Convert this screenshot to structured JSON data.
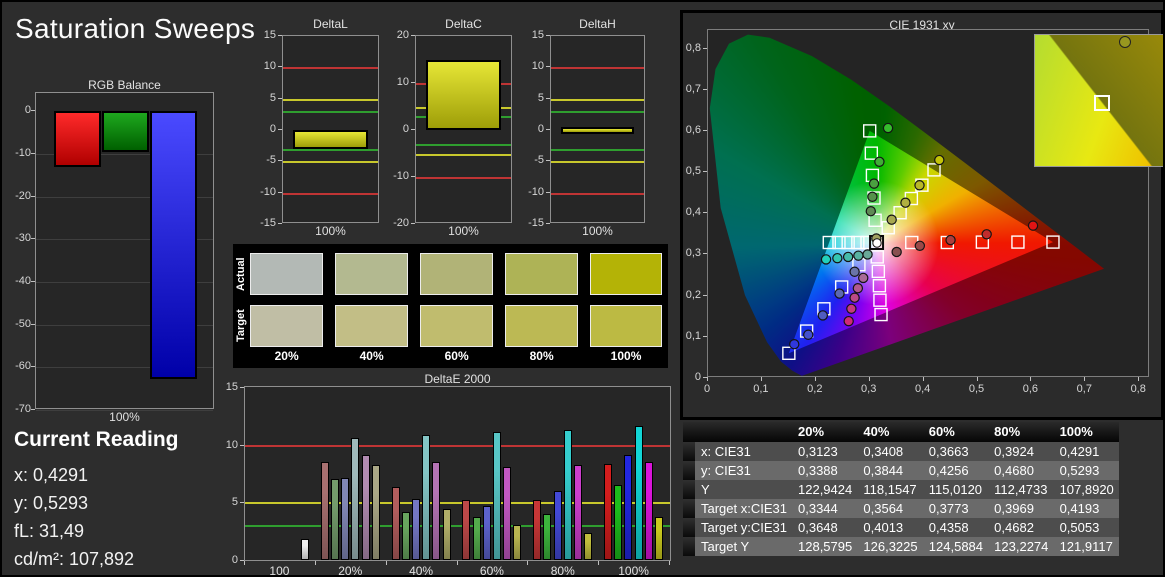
{
  "page": {
    "title": "Saturation Sweeps"
  },
  "current_reading": {
    "title": "Current Reading",
    "lines": [
      "x: 0,4291",
      "y: 0,5293",
      "fL: 31,49",
      "cd/m²: 107,892"
    ]
  },
  "swatches": {
    "row_labels": [
      "Actual",
      "Target"
    ],
    "col_labels": [
      "20%",
      "40%",
      "60%",
      "80%",
      "100%"
    ],
    "actual_colors": [
      "#b3b9b5",
      "#b3b990",
      "#b1b377",
      "#aeb356",
      "#b4b306"
    ],
    "target_colors": [
      "#c0bea5",
      "#c2be86",
      "#c0bc6e",
      "#bcb954",
      "#bcba43"
    ]
  },
  "readings_table": {
    "column_headers": [
      "20%",
      "40%",
      "60%",
      "80%",
      "100%"
    ],
    "rows": [
      {
        "label": "x: CIE31",
        "values": [
          "0,3123",
          "0,3408",
          "0,3663",
          "0,3924",
          "0,4291"
        ]
      },
      {
        "label": "y: CIE31",
        "values": [
          "0,3388",
          "0,3844",
          "0,4256",
          "0,4680",
          "0,5293"
        ]
      },
      {
        "label": "Y",
        "values": [
          "122,9424",
          "118,1547",
          "115,0120",
          "112,4733",
          "107,8920"
        ]
      },
      {
        "label": "Target x:CIE31",
        "values": [
          "0,3344",
          "0,3564",
          "0,3773",
          "0,3969",
          "0,4193"
        ]
      },
      {
        "label": "Target y:CIE31",
        "values": [
          "0,3648",
          "0,4013",
          "0,4358",
          "0,4682",
          "0,5053"
        ]
      },
      {
        "label": "Target Y",
        "values": [
          "128,5795",
          "126,3225",
          "124,5884",
          "123,2274",
          "121,9117"
        ]
      }
    ]
  },
  "chart_data": {
    "rgb_balance": {
      "type": "bar",
      "title": "RGB Balance",
      "x_label": "100%",
      "categories": [
        "Red",
        "Green",
        "Blue"
      ],
      "values": [
        -13.1,
        -9.6,
        -62.8
      ],
      "ylim": [
        -70,
        0
      ],
      "y_ticks": [
        "0",
        "-10",
        "-20",
        "-30",
        "-40",
        "-50",
        "-60",
        "-70"
      ],
      "bar_gradients": [
        [
          "#ff2a2a",
          "#b00000"
        ],
        [
          "#1ea81e",
          "#006000"
        ],
        [
          "#4a4aff",
          "#0000a8"
        ]
      ]
    },
    "delta_ref_lines": [
      {
        "value": 10,
        "color": "#bf3434"
      },
      {
        "value": 5,
        "color": "#c8c82c"
      },
      {
        "value": 3,
        "color": "#2f9e2f"
      },
      {
        "value": -3,
        "color": "#2f9e2f"
      },
      {
        "value": -5,
        "color": "#c8c82c"
      },
      {
        "value": -10,
        "color": "#bf3434"
      }
    ],
    "delta_charts": [
      {
        "title": "DeltaL",
        "type": "bar",
        "x_label": "100%",
        "ymax": 15,
        "y_ticks": [
          "15",
          "10",
          "5",
          "0",
          "-5",
          "-10",
          "-15"
        ],
        "value": -3.1
      },
      {
        "title": "DeltaC",
        "type": "bar",
        "x_label": "100%",
        "ymax": 20,
        "y_ticks": [
          "20",
          "10",
          "0",
          "-10",
          "-20"
        ],
        "value": 15.0
      },
      {
        "title": "DeltaH",
        "type": "bar",
        "x_label": "100%",
        "ymax": 15,
        "y_ticks": [
          "15",
          "10",
          "5",
          "0",
          "-5",
          "-10",
          "-15"
        ],
        "value": -0.2
      }
    ],
    "deltaE2000": {
      "type": "grouped-bar",
      "title": "DeltaE 2000",
      "ylim": [
        0,
        15
      ],
      "y_ticks": [
        "15",
        "10",
        "5",
        "0"
      ],
      "ref_lines": [
        {
          "value": 10,
          "color": "#bf3434"
        },
        {
          "value": 5,
          "color": "#c8c82c"
        },
        {
          "value": 3,
          "color": "#2f9e2f"
        }
      ],
      "series_order": [
        "red",
        "green",
        "blue",
        "cyan",
        "magenta",
        "yellow"
      ],
      "groups": [
        {
          "label": "100",
          "values": [
            null,
            null,
            null,
            null,
            null,
            1.8
          ],
          "colors": [
            null,
            null,
            null,
            null,
            null,
            "#ededed"
          ]
        },
        {
          "label": "20%",
          "values": [
            8.5,
            7.0,
            7.1,
            10.6,
            9.1,
            8.2
          ],
          "colors": [
            "#a87070",
            "#739b6b",
            "#8187b6",
            "#9fb9ba",
            "#b18bb1",
            "#aaa785"
          ]
        },
        {
          "label": "40%",
          "values": [
            6.3,
            4.2,
            5.3,
            10.8,
            8.5,
            4.4
          ],
          "colors": [
            "#b25d5d",
            "#68a55e",
            "#7477c4",
            "#83c4c4",
            "#b573b5",
            "#b0ad68"
          ]
        },
        {
          "label": "60%",
          "values": [
            5.2,
            3.7,
            4.7,
            11.1,
            8.1,
            3.0
          ],
          "colors": [
            "#bc4848",
            "#54ab4c",
            "#5c62cc",
            "#58c6c6",
            "#c258c2",
            "#b8b550"
          ]
        },
        {
          "label": "80%",
          "values": [
            5.2,
            4.0,
            6.0,
            11.3,
            8.2,
            2.3
          ],
          "colors": [
            "#c63636",
            "#3cb43c",
            "#4349d6",
            "#35cdcd",
            "#cc3ecc",
            "#c0bd3c"
          ]
        },
        {
          "label": "100%",
          "values": [
            8.3,
            6.5,
            9.1,
            11.6,
            8.5,
            3.7
          ],
          "colors": [
            "#d41d1d",
            "#1cbc1c",
            "#2227e2",
            "#12d6d6",
            "#da14da",
            "#c9c91e"
          ]
        }
      ]
    },
    "cie1931": {
      "type": "scatter",
      "title": "CIE 1931 xy",
      "xlim": [
        0,
        0.82
      ],
      "ylim": [
        0,
        0.845
      ],
      "x_ticks": [
        "0",
        "0,1",
        "0,2",
        "0,3",
        "0,4",
        "0,5",
        "0,6",
        "0,7",
        "0,8"
      ],
      "y_ticks": [
        "0",
        "0,1",
        "0,2",
        "0,3",
        "0,4",
        "0,5",
        "0,6",
        "0,7",
        "0,8"
      ],
      "white_point": [
        0.3127,
        0.329
      ],
      "gamut_triangle": {
        "red": [
          0.64,
          0.33
        ],
        "green": [
          0.3,
          0.6
        ],
        "blue": [
          0.15,
          0.06
        ]
      },
      "sweeps": [
        {
          "name": "red",
          "targets": [
            [
              0.378,
              0.329
            ],
            [
              0.444,
              0.329
            ],
            [
              0.509,
              0.33
            ],
            [
              0.575,
              0.33
            ],
            [
              0.64,
              0.33
            ]
          ],
          "measured": [
            [
              0.35,
              0.306
            ],
            [
              0.393,
              0.321
            ],
            [
              0.45,
              0.335
            ],
            [
              0.517,
              0.349
            ],
            [
              0.603,
              0.37
            ]
          ],
          "point_colors": [
            "#8a5050",
            "#9a4848",
            "#ad3d3d",
            "#c22c2c",
            "#e01414"
          ]
        },
        {
          "name": "green",
          "targets": [
            [
              0.31,
              0.383
            ],
            [
              0.308,
              0.437
            ],
            [
              0.305,
              0.492
            ],
            [
              0.303,
              0.546
            ],
            [
              0.3,
              0.6
            ]
          ],
          "measured": [
            [
              0.302,
              0.405
            ],
            [
              0.305,
              0.44
            ],
            [
              0.308,
              0.472
            ],
            [
              0.318,
              0.525
            ],
            [
              0.334,
              0.607
            ]
          ],
          "point_colors": [
            "#5f8a55",
            "#55924b",
            "#4aa040",
            "#3fae36",
            "#35bc2c"
          ]
        },
        {
          "name": "blue",
          "targets": [
            [
              0.28,
              0.275
            ],
            [
              0.248,
              0.221
            ],
            [
              0.215,
              0.168
            ],
            [
              0.183,
              0.114
            ],
            [
              0.15,
              0.06
            ]
          ],
          "measured": [
            [
              0.272,
              0.258
            ],
            [
              0.244,
              0.205
            ],
            [
              0.213,
              0.152
            ],
            [
              0.186,
              0.105
            ],
            [
              0.16,
              0.082
            ]
          ],
          "point_colors": [
            "#6a74a8",
            "#5d68b2",
            "#505cc0",
            "#4450ce",
            "#3038dc"
          ]
        },
        {
          "name": "cyan",
          "targets": [
            [
              0.295,
              0.329
            ],
            [
              0.278,
              0.329
            ],
            [
              0.26,
              0.329
            ],
            [
              0.243,
              0.329
            ],
            [
              0.225,
              0.329
            ]
          ],
          "measured": [
            [
              0.296,
              0.3
            ],
            [
              0.279,
              0.297
            ],
            [
              0.26,
              0.294
            ],
            [
              0.24,
              0.291
            ],
            [
              0.219,
              0.288
            ]
          ],
          "point_colors": [
            "#6aa898",
            "#58b2a2",
            "#46bcaa",
            "#34c6b2",
            "#22d0bc"
          ]
        },
        {
          "name": "magenta",
          "targets": [
            [
              0.314,
              0.294
            ],
            [
              0.316,
              0.259
            ],
            [
              0.318,
              0.224
            ],
            [
              0.319,
              0.189
            ],
            [
              0.321,
              0.154
            ]
          ],
          "measured": [
            [
              0.288,
              0.243
            ],
            [
              0.278,
              0.218
            ],
            [
              0.272,
              0.195
            ],
            [
              0.266,
              0.168
            ],
            [
              0.261,
              0.138
            ]
          ],
          "point_colors": [
            "#a86a96",
            "#b25a8e",
            "#bc4a86",
            "#c63a7e",
            "#d02a76"
          ]
        },
        {
          "name": "yellow",
          "targets": [
            [
              0.3344,
              0.3648
            ],
            [
              0.3564,
              0.4013
            ],
            [
              0.3773,
              0.4358
            ],
            [
              0.3969,
              0.4682
            ],
            [
              0.4193,
              0.5053
            ]
          ],
          "measured": [
            [
              0.3123,
              0.3388
            ],
            [
              0.3408,
              0.3844
            ],
            [
              0.3663,
              0.4256
            ],
            [
              0.3924,
              0.468
            ],
            [
              0.4291,
              0.5293
            ]
          ],
          "point_colors": [
            "#a0a060",
            "#a8a850",
            "#b0b040",
            "#b8b828",
            "#c4c408"
          ]
        }
      ]
    }
  }
}
